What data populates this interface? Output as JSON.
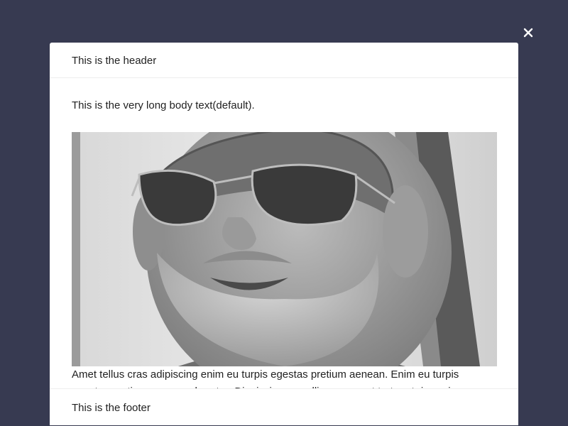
{
  "modal": {
    "close_icon": "close-icon",
    "header": "This is the header",
    "body_intro": "This is the very long body text(default).",
    "body_paragraph": "Amet tellus cras adipiscing enim eu turpis egestas pretium aenean. Enim eu turpis egestas pretium aenean pharetra. Dignissim convallis aenean et tortor at risus viverra adipiscing. Nibh tortor id aliquet lectus proin nibh.",
    "footer": "This is the footer"
  },
  "colors": {
    "backdrop": "#373a51",
    "modal_bg": "#ffffff",
    "text": "#222222",
    "divider": "#eeeeee"
  }
}
